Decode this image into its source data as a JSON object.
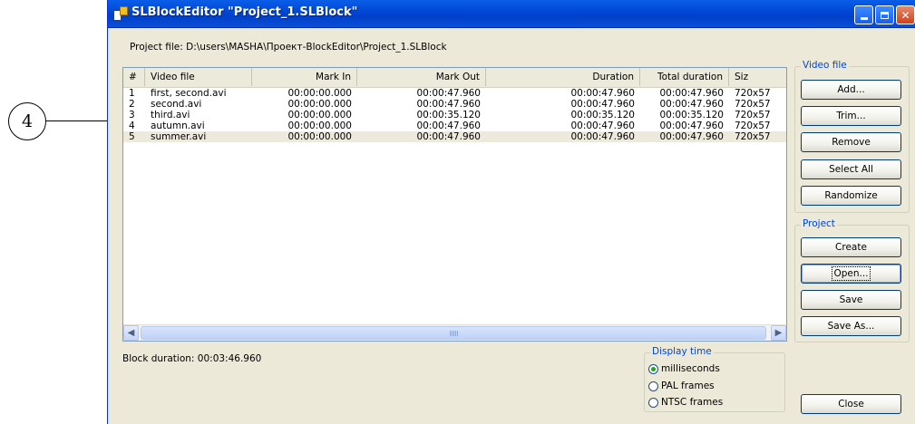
{
  "callout": {
    "number": "4"
  },
  "window": {
    "title": "SLBlockEditor \"Project_1.SLBlock\""
  },
  "project_file": {
    "label": "Project file:",
    "path": "D:\\users\\MASHA\\Проект-BlockEditor\\Project_1.SLBlock"
  },
  "table": {
    "columns": [
      "#",
      "Video file",
      "Mark In",
      "Mark Out",
      "Duration",
      "Total duration",
      "Siz"
    ],
    "rows": [
      [
        "1",
        "first, second.avi",
        "00:00:00.000",
        "00:00:47.960",
        "00:00:47.960",
        "00:00:47.960",
        "720x57"
      ],
      [
        "2",
        "second.avi",
        "00:00:00.000",
        "00:00:47.960",
        "00:00:47.960",
        "00:00:47.960",
        "720x57"
      ],
      [
        "3",
        "third.avi",
        "00:00:00.000",
        "00:00:35.120",
        "00:00:35.120",
        "00:00:35.120",
        "720x57"
      ],
      [
        "4",
        "autumn.avi",
        "00:00:00.000",
        "00:00:47.960",
        "00:00:47.960",
        "00:00:47.960",
        "720x57"
      ],
      [
        "5",
        "summer.avi",
        "00:00:00.000",
        "00:00:47.960",
        "00:00:47.960",
        "00:00:47.960",
        "720x57"
      ]
    ],
    "selected_row": 5
  },
  "block_duration": "Block duration: 00:03:46.960",
  "video_file_group": {
    "title": "Video file",
    "buttons": {
      "add": "Add...",
      "trim": "Trim...",
      "remove": "Remove",
      "select_all": "Select All",
      "randomize": "Randomize"
    }
  },
  "project_group": {
    "title": "Project",
    "buttons": {
      "create": "Create",
      "open": "Open...",
      "save": "Save",
      "save_as": "Save As..."
    }
  },
  "display_time": {
    "title": "Display time",
    "options": [
      "milliseconds",
      "PAL frames",
      "NTSC frames"
    ],
    "selected": "milliseconds"
  },
  "close_button": "Close",
  "colors": {
    "title_bar": "#0046d5",
    "group_title": "#0046d5",
    "selected_row": "#ede9dc",
    "radio_dot": "#21a121"
  }
}
